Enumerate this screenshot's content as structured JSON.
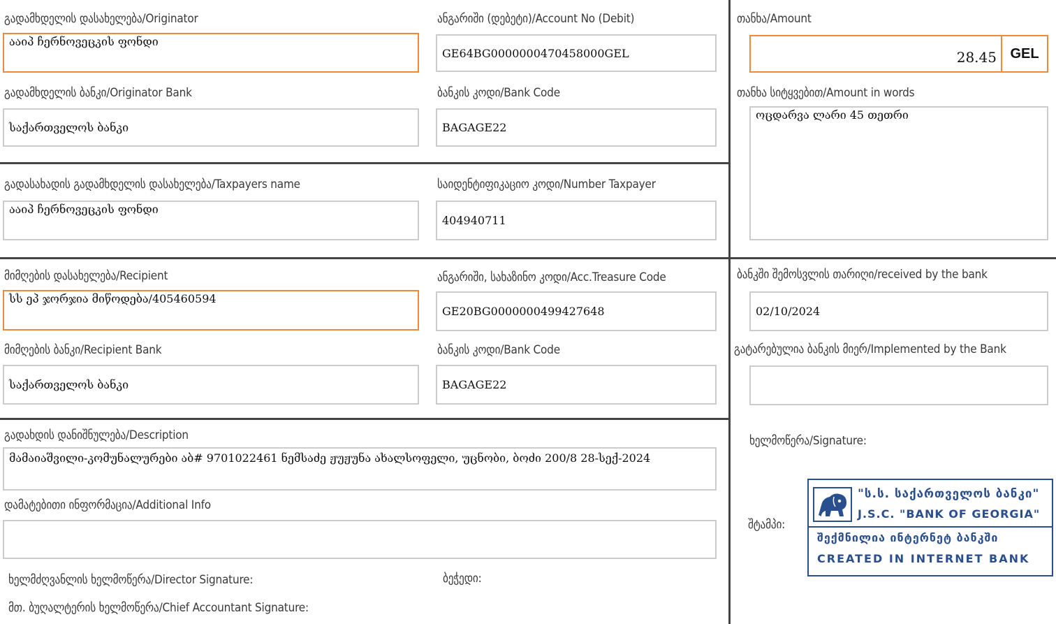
{
  "originator": {
    "label": "გადამხდელის დასახელება/Originator",
    "value": "ააიპ ჩერნოვეცკის ფონდი"
  },
  "account_debit": {
    "label": "ანგარიში (დებეტი)/Account No (Debit)",
    "value": "GE64BG0000000470458000GEL"
  },
  "amount": {
    "label": "თანხა/Amount",
    "value": "28.45",
    "currency": "GEL"
  },
  "originator_bank": {
    "label": "გადამხდელის ბანკი/Originator Bank",
    "value": "საქართველოს ბანკი"
  },
  "originator_bank_code": {
    "label": "ბანკის კოდი/Bank Code",
    "value": "BAGAGE22"
  },
  "amount_words": {
    "label": "თანხა სიტყვებით/Amount in words",
    "value": "ოცდარვა ლარი 45 თეთრი"
  },
  "taxpayer_name": {
    "label": "გადასახადის გადამხდელის დასახელება/Taxpayers name",
    "value": "ააიპ ჩერნოვეცკის ფონდი"
  },
  "taxpayer_number": {
    "label": "საიდენტიფიკაციო კოდი/Number Taxpayer",
    "value": "404940711"
  },
  "recipient": {
    "label": "მიმღების დასახელება/Recipient",
    "value": "სს ეპ ჯორჯია მიწოდება/405460594"
  },
  "treasury_code": {
    "label": "ანგარიში, სახაზინო კოდი/Acc.Treasure Code",
    "value": "GE20BG0000000499427648"
  },
  "received_date": {
    "label": "ბანკში შემოსვლის თარიღი/received by the bank",
    "value": "02/10/2024"
  },
  "recipient_bank": {
    "label": "მიმღების ბანკი/Recipient Bank",
    "value": "საქართველოს ბანკი"
  },
  "recipient_bank_code": {
    "label": "ბანკის კოდი/Bank Code",
    "value": "BAGAGE22"
  },
  "implemented": {
    "label": "გატარებულია ბანკის მიერ/Implemented by the Bank",
    "value": ""
  },
  "description": {
    "label": "გადახდის დანიშნულება/Description",
    "value": "მამაიაშვილი-კომუნალურები აბ# 9701022461 ნემსაძე ჟუჟუნა ახალსოფელი, უცნობი, ბოძი 200/8 28-სექ-2024"
  },
  "additional_info": {
    "label": "დამატებითი ინფორმაცია/Additional Info",
    "value": ""
  },
  "signatures": {
    "signature_label": "ხელმოწერა/Signature:",
    "stamp_label": "შტამპი:",
    "director": "ხელმძღვანლის ხელმოწერა/Director Signature:",
    "seal": "ბეჭედი:",
    "accountant": "მთ. ბუღალტერის ხელმოწერა/Chief Accountant Signature:"
  },
  "stamp": {
    "line1": "\"ს.ს. საქართველოს ბანკი\"",
    "line2": "J.S.C. \"BANK OF GEORGIA\"",
    "line3": "შექმნილია ინტერნეტ ბანკში",
    "line4": "CREATED IN INTERNET BANK",
    "color": "#2a4f8f"
  }
}
